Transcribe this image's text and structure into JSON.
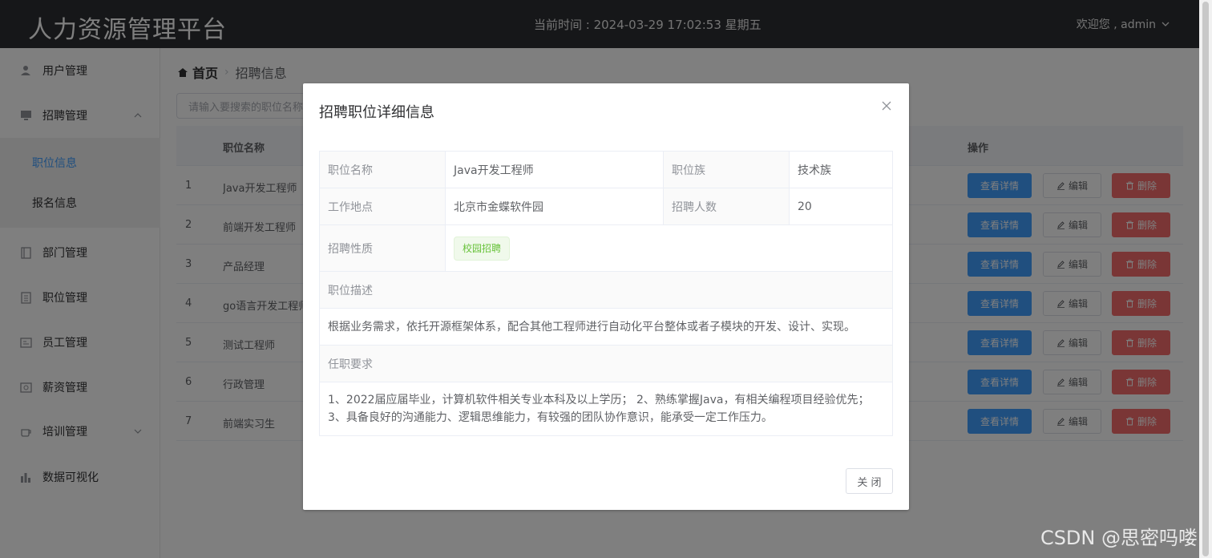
{
  "header": {
    "title": "人力资源管理平台",
    "clock": "当前时间 : 2024-03-29 17:02:53 星期五",
    "user": "欢迎您 , admin"
  },
  "sidebar": {
    "items": [
      {
        "label": "用户管理",
        "icon": "user-icon"
      },
      {
        "label": "招聘管理",
        "icon": "monitor-icon"
      },
      {
        "label": "部门管理",
        "icon": "notebook-icon"
      },
      {
        "label": "职位管理",
        "icon": "document-icon"
      },
      {
        "label": "员工管理",
        "icon": "tickets-icon"
      },
      {
        "label": "薪资管理",
        "icon": "money-icon"
      },
      {
        "label": "培训管理",
        "icon": "coffee-cup-icon"
      },
      {
        "label": "数据可视化",
        "icon": "histogram-icon"
      }
    ],
    "sub_items": [
      {
        "label": "职位信息",
        "active": true
      },
      {
        "label": "报名信息",
        "active": false
      }
    ]
  },
  "breadcrumb": {
    "home": "首页",
    "current": "招聘信息"
  },
  "search": {
    "placeholder": "请输入要搜索的职位名称"
  },
  "table": {
    "col_name": "职位名称",
    "col_ops": "操作",
    "btn_view": "查看详情",
    "btn_edit": "编辑",
    "btn_delete": "删除",
    "rows": [
      {
        "idx": "1",
        "name": "Java开发工程师"
      },
      {
        "idx": "2",
        "name": "前端开发工程师"
      },
      {
        "idx": "3",
        "name": "产品经理"
      },
      {
        "idx": "4",
        "name": "go语言开发工程师"
      },
      {
        "idx": "5",
        "name": "测试工程师"
      },
      {
        "idx": "6",
        "name": "行政管理"
      },
      {
        "idx": "7",
        "name": "前端实习生"
      }
    ]
  },
  "dialog": {
    "title": "招聘职位详细信息",
    "label_name": "职位名称",
    "val_name": "Java开发工程师",
    "label_family": "职位族",
    "val_family": "技术族",
    "label_location": "工作地点",
    "val_location": "北京市金蝶软件园",
    "label_count": "招聘人数",
    "val_count": "20",
    "label_type": "招聘性质",
    "val_type": "校园招聘",
    "label_desc": "职位描述",
    "val_desc": "根据业务需求，依托开源框架体系，配合其他工程师进行自动化平台整体或者子模块的开发、设计、实现。",
    "label_req": "任职要求",
    "val_req_line1": "1、2022届应届毕业，计算机软件相关专业本科及以上学历； 2、熟练掌握Java，有相关编程项目经验优先；",
    "val_req_line2": "3、具备良好的沟通能力、逻辑思维能力，有较强的团队协作意识，能承受一定工作压力。",
    "close_label": "关 闭"
  },
  "watermark": "CSDN @思密吗喽",
  "colors": {
    "header_bg": "#2d2f33",
    "primary": "#409eff",
    "danger": "#f56c6c",
    "success": "#67c23a"
  }
}
